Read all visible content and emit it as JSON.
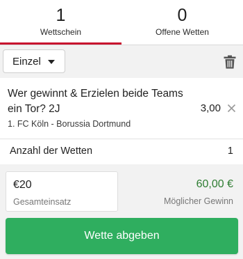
{
  "tabs": [
    {
      "count": "1",
      "label": "Wettschein",
      "active": true
    },
    {
      "count": "0",
      "label": "Offene Wetten",
      "active": false
    }
  ],
  "toolbar": {
    "bet_type": "Einzel",
    "delete_icon": "trash-icon"
  },
  "selection": {
    "market": "Wer gewinnt & Erzielen beide Teams ein Tor? 2J",
    "match": "1. FC Köln - Borussia Dortmund",
    "odds": "3,00",
    "remove_icon": "close-icon"
  },
  "bet_count": {
    "label": "Anzahl der Wetten",
    "value": "1"
  },
  "stake": {
    "amount": "€20",
    "label": "Gesamteinsatz"
  },
  "potential_win": {
    "amount": "60,00 €",
    "label": "Möglicher Gewinn"
  },
  "submit_label": "Wette abgeben",
  "colors": {
    "accent": "#c8102e",
    "win": "#2e7d32",
    "submit": "#2fae5f",
    "panel": "#f2f2f2"
  }
}
